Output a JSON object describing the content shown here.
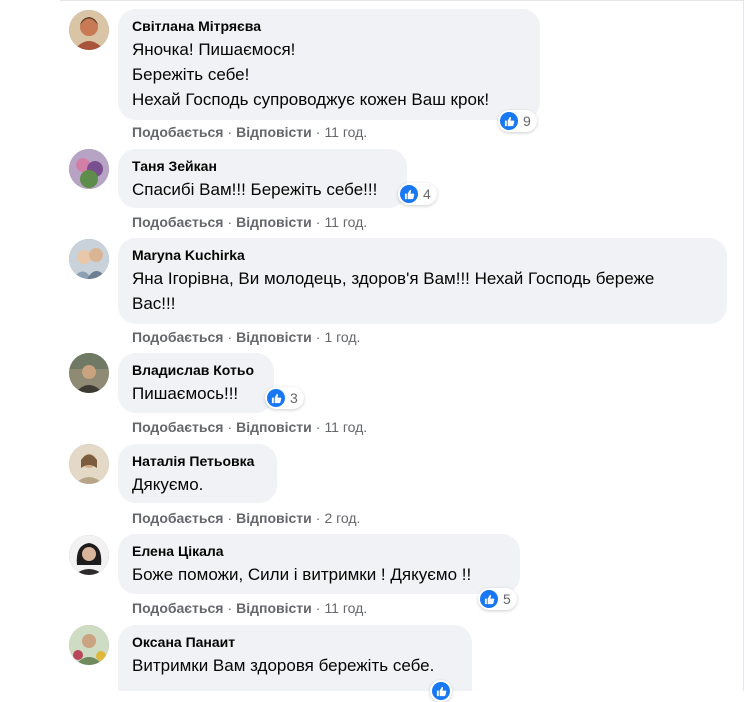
{
  "comments": [
    {
      "author": "Світлана Мітряєва",
      "lines": [
        "Яночка! Пишаємося!",
        "Бережіть себе!",
        "Нехай Господь супроводжує кожен Ваш крок!"
      ],
      "reactions": "9",
      "like_label": "Подобається",
      "reply_label": "Відповісти",
      "time": "11 год.",
      "avatar_color": "#a8543a"
    },
    {
      "author": "Таня Зейкан",
      "lines": [
        "Спасибі Вам!!! Бережіть себе!!!"
      ],
      "reactions": "4",
      "like_label": "Подобається",
      "reply_label": "Відповісти",
      "time": "11 год.",
      "avatar_color": "#8e6aa0"
    },
    {
      "author": "Maryna Kuchirka",
      "lines": [
        "Яна Ігорівна, Ви молодець, здоров'я Вам!!! Нехай Господь береже",
        "Вас!!!"
      ],
      "reactions": "",
      "like_label": "Подобається",
      "reply_label": "Відповісти",
      "time": "1 год.",
      "avatar_color": "#9aa6b4"
    },
    {
      "author": "Владислав Котьо",
      "lines": [
        "Пишаємось!!!"
      ],
      "reactions": "3",
      "like_label": "Подобається",
      "reply_label": "Відповісти",
      "time": "11 год.",
      "avatar_color": "#6d6a5a"
    },
    {
      "author": "Наталія Петьовка",
      "lines": [
        "Дякуємо."
      ],
      "reactions": "",
      "like_label": "Подобається",
      "reply_label": "Відповісти",
      "time": "2 год.",
      "avatar_color": "#b8a487"
    },
    {
      "author": "Елена Цікала",
      "lines": [
        "Боже поможи, Сили і витримки ! Дякуємо !!"
      ],
      "reactions": "5",
      "like_label": "Подобається",
      "reply_label": "Відповісти",
      "time": "11 год.",
      "avatar_color": "#2e2b2c"
    },
    {
      "author": "Оксана Панаит",
      "lines": [
        "Витримки Вам здоровя бережіть себе."
      ],
      "reactions": "",
      "like_label": "",
      "reply_label": "",
      "time": "",
      "avatar_color": "#6f8a5d"
    }
  ],
  "colors": {
    "bubble": "#f0f2f5",
    "like_blue": "#1877f2",
    "meta_gray": "#65676b"
  }
}
